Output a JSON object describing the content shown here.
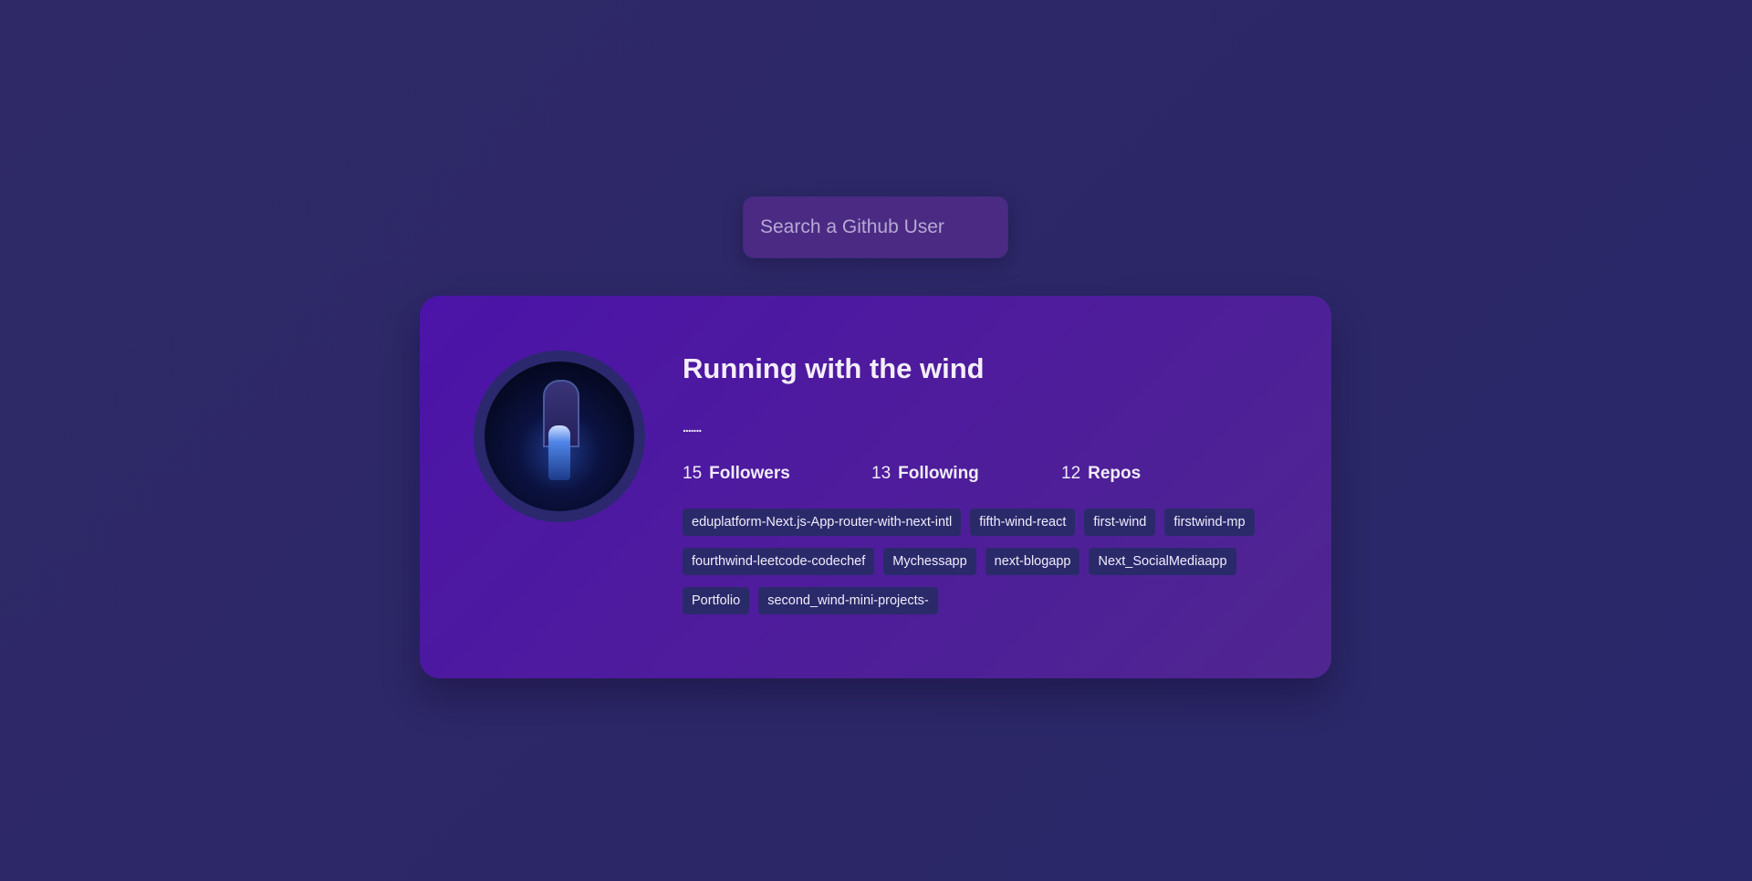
{
  "search": {
    "placeholder": "Search a Github User",
    "value": ""
  },
  "profile": {
    "name": "Running with the wind",
    "bio": ".......",
    "stats": [
      {
        "count": "15",
        "label": "Followers"
      },
      {
        "count": "13",
        "label": "Following"
      },
      {
        "count": "12",
        "label": "Repos"
      }
    ],
    "repos": [
      "eduplatform-Next.js-App-router-with-next-intl",
      "fifth-wind-react",
      "first-wind",
      "firstwind-mp",
      "fourthwind-leetcode-codechef",
      "Mychessapp",
      "next-blogapp",
      "Next_SocialMediaapp",
      "Portfolio",
      "second_wind-mini-projects-"
    ]
  }
}
